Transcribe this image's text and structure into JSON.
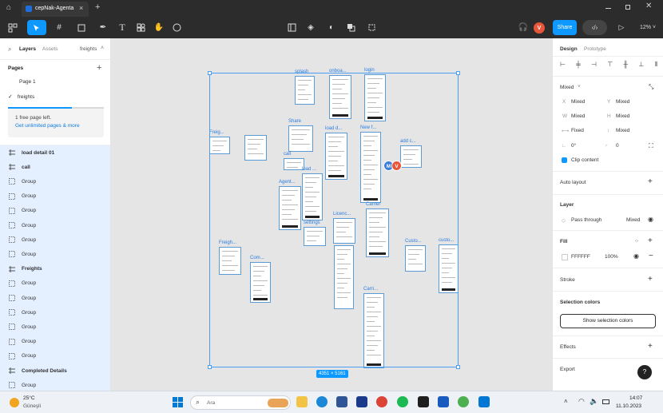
{
  "window": {
    "home_icon": "home-icon",
    "tab_title": "cepNak-Agenta",
    "tab_close": "×",
    "new_tab": "+",
    "controls": [
      "minimize",
      "maximize",
      "close"
    ]
  },
  "toolbar": {
    "share_label": "Share",
    "zoom": "12%",
    "avatar_initial": "V",
    "avatar_color": "#e8553a",
    "accent": "#0d99ff"
  },
  "left_panel": {
    "tabs": [
      "Layers",
      "Assets"
    ],
    "page_selector": "freights",
    "pages_title": "Pages",
    "pages": [
      {
        "name": "Page 1",
        "selected": false
      },
      {
        "name": "freights",
        "selected": true
      }
    ],
    "upgrade_text": "1 free page left.",
    "upgrade_link": "Get unlimited pages & more",
    "layers": [
      {
        "name": "load detail 01",
        "type": "frame",
        "bold": true
      },
      {
        "name": "call",
        "type": "frame",
        "bold": true
      },
      {
        "name": "Group",
        "type": "group",
        "bold": false
      },
      {
        "name": "Group",
        "type": "group",
        "bold": false
      },
      {
        "name": "Group",
        "type": "group",
        "bold": false
      },
      {
        "name": "Group",
        "type": "group",
        "bold": false
      },
      {
        "name": "Group",
        "type": "group",
        "bold": false
      },
      {
        "name": "Group",
        "type": "group",
        "bold": false
      },
      {
        "name": "Freights",
        "type": "frame",
        "bold": true
      },
      {
        "name": "Group",
        "type": "group",
        "bold": false
      },
      {
        "name": "Group",
        "type": "group",
        "bold": false
      },
      {
        "name": "Group",
        "type": "group",
        "bold": false
      },
      {
        "name": "Group",
        "type": "group",
        "bold": false
      },
      {
        "name": "Group",
        "type": "group",
        "bold": false
      },
      {
        "name": "Group",
        "type": "group",
        "bold": false
      },
      {
        "name": "Completed Details",
        "type": "frame",
        "bold": true
      },
      {
        "name": "Group",
        "type": "group",
        "bold": false
      }
    ]
  },
  "canvas": {
    "frames": [
      "splash",
      "onboa...",
      "login",
      "Share",
      "load d...",
      "New f...",
      "Freig...",
      "call",
      "load ...",
      "add c...",
      "Agent...",
      "settings",
      "Licenc...",
      "Carrier",
      "Freigh...",
      "Com...",
      "Custo...",
      "custo...",
      "Carri..."
    ],
    "selection_size": "4351 × 5161",
    "cursors": [
      {
        "initial": "M",
        "color": "#3b7ddd"
      },
      {
        "initial": "V",
        "color": "#e8553a"
      }
    ]
  },
  "right_panel": {
    "tabs": [
      "Design",
      "Prototype"
    ],
    "mixed_label": "Mixed",
    "x_label": "X",
    "x_value": "Mixed",
    "y_label": "Y",
    "y_value": "Mixed",
    "w_label": "W",
    "w_value": "Mixed",
    "h_label": "H",
    "h_value": "Mixed",
    "width_mode": "Fixed",
    "height_mode": "Mixed",
    "rotation": "0°",
    "radius": "0",
    "clip_content": "Clip content",
    "auto_layout": "Auto layout",
    "layer_title": "Layer",
    "blend_mode": "Pass through",
    "opacity_mixed": "Mixed",
    "fill_title": "Fill",
    "fill_hex": "FFFFFF",
    "fill_opacity": "100%",
    "stroke_title": "Stroke",
    "selection_colors_title": "Selection colors",
    "show_selection_colors": "Show selection colors",
    "effects_title": "Effects",
    "export_title": "Export",
    "help": "?"
  },
  "taskbar": {
    "weather_temp": "25°C",
    "weather_desc": "Güneşli",
    "search_placeholder": "Ara",
    "time": "14:07",
    "date": "11.10.2023"
  }
}
